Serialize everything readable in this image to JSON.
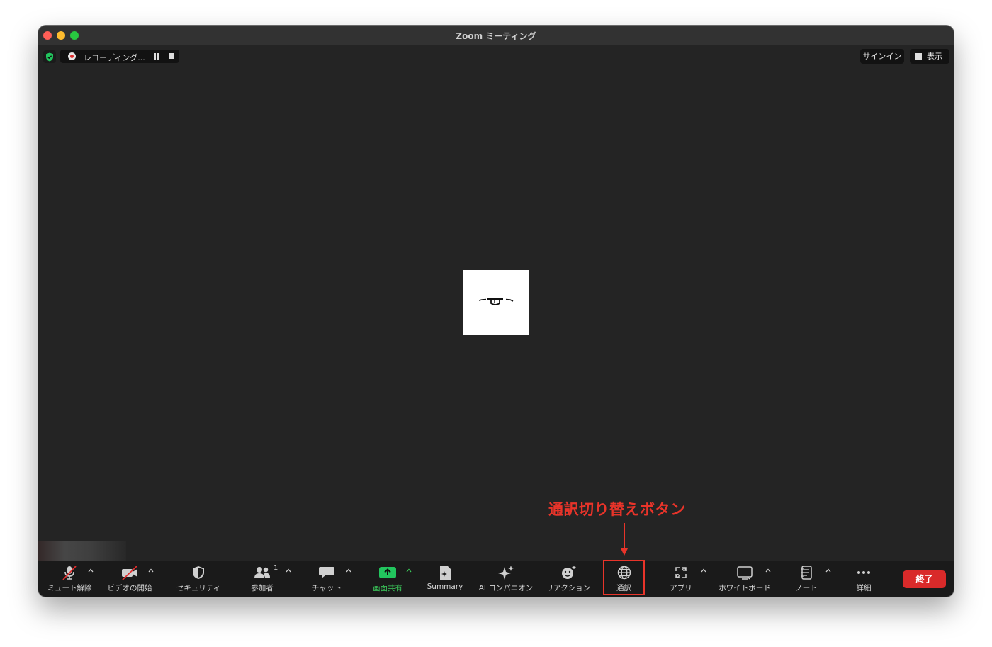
{
  "window": {
    "title": "Zoom ミーティング"
  },
  "recording": {
    "label": "レコーディング..."
  },
  "top_right": {
    "signin_label": "サインイン",
    "view_label": "表示"
  },
  "annotation": {
    "text": "通訳切り替えボタン",
    "color": "#e8342a"
  },
  "toolbar": {
    "items": [
      {
        "label": "ミュート解除",
        "icon": "microphone-muted-icon",
        "has_caret": true
      },
      {
        "label": "ビデオの開始",
        "icon": "video-off-icon",
        "has_caret": true
      },
      {
        "label": "セキュリティ",
        "icon": "shield-icon",
        "has_caret": false
      },
      {
        "label": "参加者",
        "icon": "participants-icon",
        "has_caret": true,
        "count": "1"
      },
      {
        "label": "チャット",
        "icon": "chat-icon",
        "has_caret": true
      },
      {
        "label": "画面共有",
        "icon": "share-screen-icon",
        "has_caret": true,
        "color": "#3ccd5c"
      },
      {
        "label": "Summary",
        "icon": "summary-icon",
        "has_caret": false
      },
      {
        "label": "AI コンパニオン",
        "icon": "sparkle-icon",
        "has_caret": false
      },
      {
        "label": "リアクション",
        "icon": "reaction-icon",
        "has_caret": false
      },
      {
        "label": "通訳",
        "icon": "globe-icon",
        "has_caret": false,
        "highlighted": true
      },
      {
        "label": "アプリ",
        "icon": "apps-icon",
        "has_caret": true
      },
      {
        "label": "ホワイトボード",
        "icon": "whiteboard-icon",
        "has_caret": true
      },
      {
        "label": "ノート",
        "icon": "notes-icon",
        "has_caret": true
      },
      {
        "label": "詳細",
        "icon": "more-icon",
        "has_caret": false
      }
    ],
    "end_label": "終了"
  },
  "colors": {
    "end_button": "#d92a2a",
    "share_green": "#22c55e",
    "security_green": "#22c55e",
    "annotation_red": "#e8342a"
  }
}
